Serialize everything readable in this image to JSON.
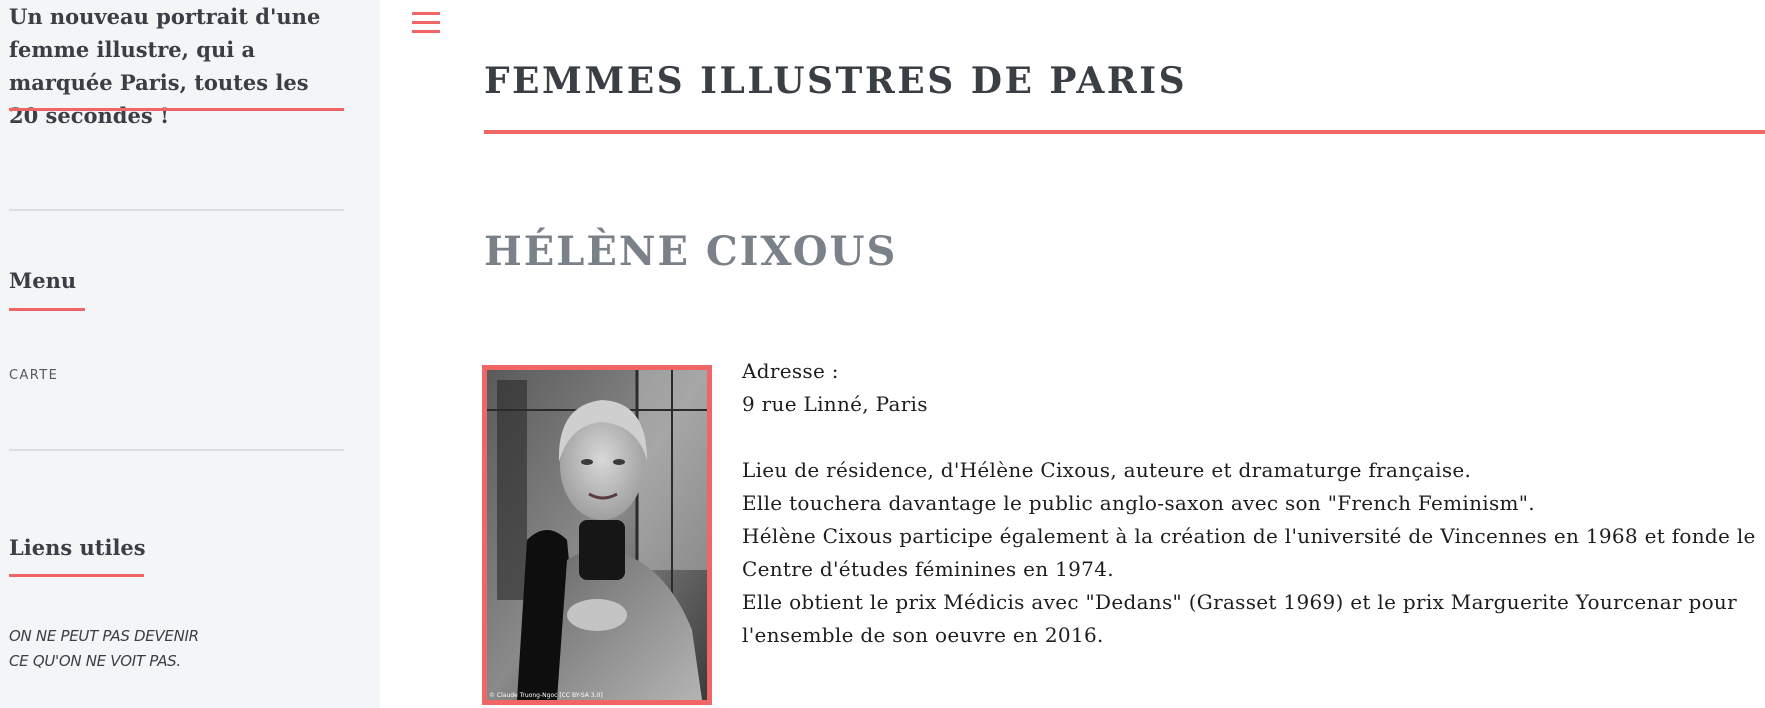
{
  "sidebar": {
    "tagline": "Un nouveau portrait d'une femme illustre, qui a marquée Paris, toutes les 20 secondes !",
    "menu_title": "Menu",
    "menu_items": [
      {
        "label": "CARTE"
      }
    ],
    "links_title": "Liens utiles",
    "quote_line1": "ON NE PEUT PAS DEVENIR",
    "quote_line2": "CE QU'ON NE VOIT PAS."
  },
  "header": {
    "menu_icon": "hamburger-icon",
    "site_title": "FEMMES ILLUSTRES DE PARIS"
  },
  "post": {
    "title": "HÉLÈNE CIXOUS",
    "photo_credit": "© Claude Truong-Ngoc [CC BY-SA 3.0]",
    "address_label": "Adresse :",
    "address": "9 rue Linné, Paris",
    "paragraphs": [
      "Lieu de résidence, d'Hélène Cixous, auteure et dramaturge française.",
      "Elle touchera davantage le public anglo-saxon avec son \"French Feminism\".",
      "Hélène Cixous participe également à la création de l'université de Vincennes en 1968 et fonde le Centre d'études féminines en 1974.",
      "Elle obtient le prix Médicis avec \"Dedans\" (Grasset 1969) et le prix Marguerite Yourcenar pour l'ensemble de son oeuvre en 2016."
    ]
  },
  "colors": {
    "accent": "#ee6666",
    "sidebar_bg": "#f4f5f7",
    "text_dark": "#3a3f45",
    "post_title": "#7a8189"
  }
}
